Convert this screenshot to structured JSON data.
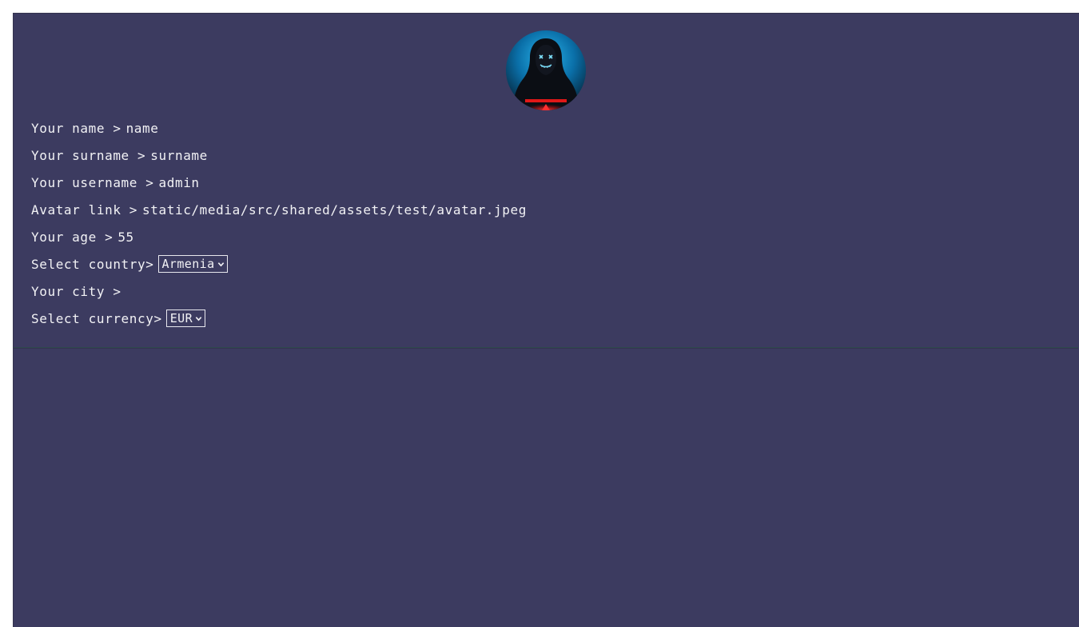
{
  "profile": {
    "avatar_icon": "hooded-hacker-avatar",
    "name_label": "Your name >",
    "name_value": "name",
    "surname_label": "Your surname >",
    "surname_value": "surname",
    "username_label": "Your username >",
    "username_value": "admin",
    "avatar_link_label": "Avatar link >",
    "avatar_link_value": "static/media/src/shared/assets/test/avatar.jpeg",
    "age_label": "Your age >",
    "age_value": "55",
    "country_label": "Select country>",
    "country_selected": "Armenia",
    "city_label": "Your city >",
    "city_value": "",
    "currency_label": "Select currency>",
    "currency_selected": "EUR"
  },
  "colors": {
    "page_background": "#3c3b60",
    "text": "#f2f2f5",
    "divider": "#2f4a4e"
  }
}
